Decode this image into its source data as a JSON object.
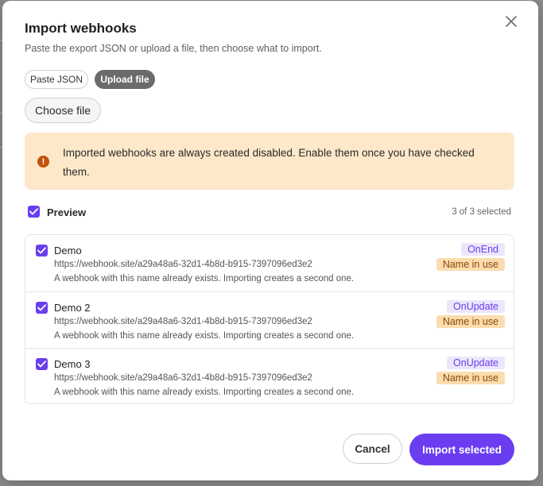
{
  "dialog": {
    "title": "Import webhooks",
    "subtitle": "Paste the export JSON or upload a file, then choose what to import.",
    "close_icon": "close-icon"
  },
  "source_toggle": {
    "options": [
      {
        "label": "Paste JSON",
        "selected": false
      },
      {
        "label": "Upload file",
        "selected": true
      }
    ]
  },
  "file": {
    "choose_label": "Choose file"
  },
  "alert": {
    "icon": "warning-circle-icon",
    "text": "Imported webhooks are always created disabled. Enable them once you have checked them.",
    "color": "#fde8c9"
  },
  "preview": {
    "label": "Preview",
    "checked": true,
    "selected_count": "3 of 3 selected"
  },
  "webhooks": [
    {
      "name": "Demo",
      "url": "https://webhook.site/a29a48a6-32d1-4b8d-b915-7397096ed3e2",
      "note": "A webhook with this name already exists. Importing creates a second one.",
      "event": "OnEnd",
      "status": "Name in use",
      "checked": true
    },
    {
      "name": "Demo 2",
      "url": "https://webhook.site/a29a48a6-32d1-4b8d-b915-7397096ed3e2",
      "note": "A webhook with this name already exists. Importing creates a second one.",
      "event": "OnUpdate",
      "status": "Name in use",
      "checked": true
    },
    {
      "name": "Demo 3",
      "url": "https://webhook.site/a29a48a6-32d1-4b8d-b915-7397096ed3e2",
      "note": "A webhook with this name already exists. Importing creates a second one.",
      "event": "OnUpdate",
      "status": "Name in use",
      "checked": true
    }
  ],
  "footer": {
    "cancel_label": "Cancel",
    "import_label": "Import selected"
  },
  "colors": {
    "accent": "#6a3df0",
    "warning_badge": "#fcdcae",
    "event_badge": "#ece6fb"
  }
}
